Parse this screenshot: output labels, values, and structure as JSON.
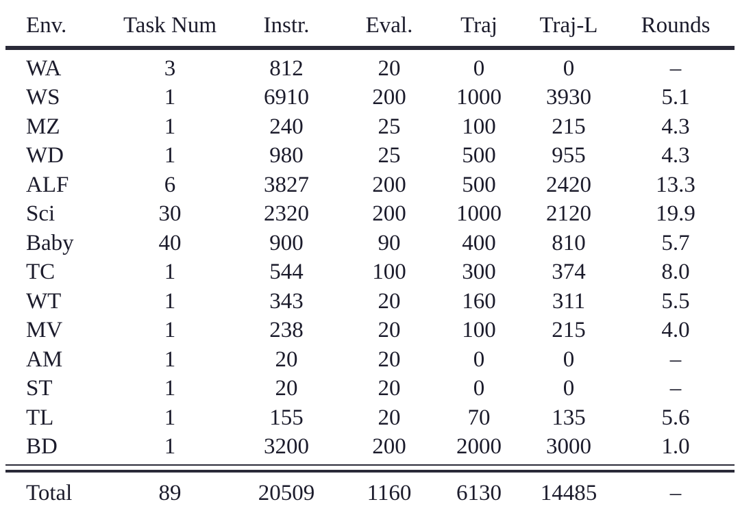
{
  "table": {
    "columns": [
      {
        "key": "env",
        "label": "Env.",
        "align": "left"
      },
      {
        "key": "task",
        "label": "Task Num",
        "align": "center"
      },
      {
        "key": "instr",
        "label": "Instr.",
        "align": "center"
      },
      {
        "key": "eval",
        "label": "Eval.",
        "align": "center"
      },
      {
        "key": "traj",
        "label": "Traj",
        "align": "center"
      },
      {
        "key": "trajl",
        "label": "Traj-L",
        "align": "center"
      },
      {
        "key": "rounds",
        "label": "Rounds",
        "align": "center"
      }
    ],
    "rows": [
      {
        "env": "WA",
        "task": "3",
        "instr": "812",
        "eval": "20",
        "traj": "0",
        "trajl": "0",
        "rounds": "–"
      },
      {
        "env": "WS",
        "task": "1",
        "instr": "6910",
        "eval": "200",
        "traj": "1000",
        "trajl": "3930",
        "rounds": "5.1"
      },
      {
        "env": "MZ",
        "task": "1",
        "instr": "240",
        "eval": "25",
        "traj": "100",
        "trajl": "215",
        "rounds": "4.3"
      },
      {
        "env": "WD",
        "task": "1",
        "instr": "980",
        "eval": "25",
        "traj": "500",
        "trajl": "955",
        "rounds": "4.3"
      },
      {
        "env": "ALF",
        "task": "6",
        "instr": "3827",
        "eval": "200",
        "traj": "500",
        "trajl": "2420",
        "rounds": "13.3"
      },
      {
        "env": "Sci",
        "task": "30",
        "instr": "2320",
        "eval": "200",
        "traj": "1000",
        "trajl": "2120",
        "rounds": "19.9"
      },
      {
        "env": "Baby",
        "task": "40",
        "instr": "900",
        "eval": "90",
        "traj": "400",
        "trajl": "810",
        "rounds": "5.7"
      },
      {
        "env": "TC",
        "task": "1",
        "instr": "544",
        "eval": "100",
        "traj": "300",
        "trajl": "374",
        "rounds": "8.0"
      },
      {
        "env": "WT",
        "task": "1",
        "instr": "343",
        "eval": "20",
        "traj": "160",
        "trajl": "311",
        "rounds": "5.5"
      },
      {
        "env": "MV",
        "task": "1",
        "instr": "238",
        "eval": "20",
        "traj": "100",
        "trajl": "215",
        "rounds": "4.0"
      },
      {
        "env": "AM",
        "task": "1",
        "instr": "20",
        "eval": "20",
        "traj": "0",
        "trajl": "0",
        "rounds": "–"
      },
      {
        "env": "ST",
        "task": "1",
        "instr": "20",
        "eval": "20",
        "traj": "0",
        "trajl": "0",
        "rounds": "–"
      },
      {
        "env": "TL",
        "task": "1",
        "instr": "155",
        "eval": "20",
        "traj": "70",
        "trajl": "135",
        "rounds": "5.6"
      },
      {
        "env": "BD",
        "task": "1",
        "instr": "3200",
        "eval": "200",
        "traj": "2000",
        "trajl": "3000",
        "rounds": "1.0"
      }
    ],
    "total": {
      "env": "Total",
      "task": "89",
      "instr": "20509",
      "eval": "1160",
      "traj": "6130",
      "trajl": "14485",
      "rounds": "–"
    },
    "colors": {
      "text": "#1b1b2b",
      "rule": "#2a2a38",
      "background": "#ffffff"
    }
  },
  "chart_data": {
    "type": "table",
    "title": "",
    "columns": [
      "Env.",
      "Task Num",
      "Instr.",
      "Eval.",
      "Traj",
      "Traj-L",
      "Rounds"
    ],
    "rows": [
      [
        "WA",
        3,
        812,
        20,
        0,
        0,
        null
      ],
      [
        "WS",
        1,
        6910,
        200,
        1000,
        3930,
        5.1
      ],
      [
        "MZ",
        1,
        240,
        25,
        100,
        215,
        4.3
      ],
      [
        "WD",
        1,
        980,
        25,
        500,
        955,
        4.3
      ],
      [
        "ALF",
        6,
        3827,
        200,
        500,
        2420,
        13.3
      ],
      [
        "Sci",
        30,
        2320,
        200,
        1000,
        2120,
        19.9
      ],
      [
        "Baby",
        40,
        900,
        90,
        400,
        810,
        5.7
      ],
      [
        "TC",
        1,
        544,
        100,
        300,
        374,
        8.0
      ],
      [
        "WT",
        1,
        343,
        20,
        160,
        311,
        5.5
      ],
      [
        "MV",
        1,
        238,
        20,
        100,
        215,
        4.0
      ],
      [
        "AM",
        1,
        20,
        20,
        0,
        0,
        null
      ],
      [
        "ST",
        1,
        20,
        20,
        0,
        0,
        null
      ],
      [
        "TL",
        1,
        155,
        20,
        70,
        135,
        5.6
      ],
      [
        "BD",
        1,
        3200,
        200,
        2000,
        3000,
        1.0
      ]
    ],
    "total_row": [
      "Total",
      89,
      20509,
      1160,
      6130,
      14485,
      null
    ]
  }
}
